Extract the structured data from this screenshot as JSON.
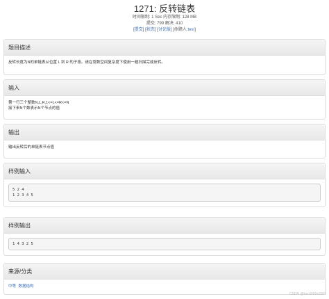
{
  "header": {
    "title": "1271: 反转链表",
    "meta_line1": "时间限制: 1 Sec  内存限制: 128 MB",
    "meta_line2": "提交: 799  解决: 410",
    "links": {
      "bracket_open": "[",
      "submit": "提交",
      "sep1": "] [",
      "status": "状态",
      "sep2": "] [",
      "discuss": "讨论版",
      "sep3": "] [命题人:",
      "author": "test",
      "bracket_close": "]"
    }
  },
  "sections": {
    "description": {
      "heading": "题目描述",
      "text": "反转长度为N的单链表从位置 L 到 R 的子段。请在常数空间复杂度下使用一趟扫描完成反转。"
    },
    "input": {
      "heading": "输入",
      "line1": "第一行三个整数N,L,R,1<=L<=R<=N",
      "line2": "接下来N个数表示N个节点的值"
    },
    "output": {
      "heading": "输出",
      "text": "输出反转后的单链表节点值"
    },
    "sample_input": {
      "heading": "样例输入",
      "text": "5 2 4\n1 2 3 4 5"
    },
    "sample_output": {
      "heading": "样例输出",
      "text": "1 4 3 2 5"
    },
    "source": {
      "heading": "来源/分类",
      "cat1": "中等",
      "cat2": "数据结构"
    }
  },
  "watermark": "CSDN @bzc0000x2003"
}
